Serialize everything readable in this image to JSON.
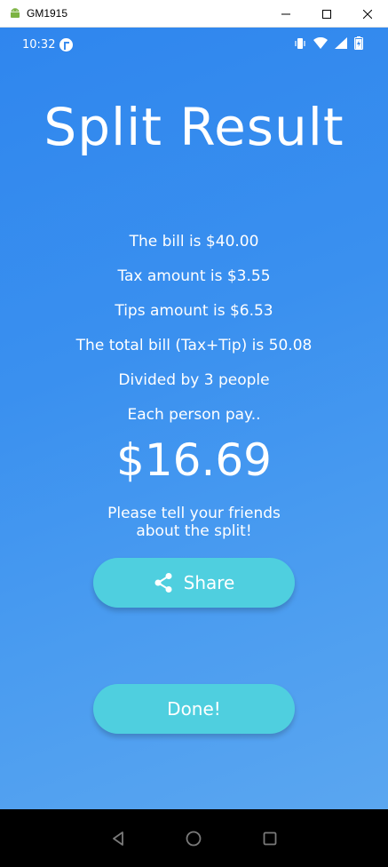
{
  "window": {
    "title": "GM1915"
  },
  "statusbar": {
    "time": "10:32"
  },
  "page": {
    "title": "Split Result",
    "lines": [
      "The bill is $40.00",
      "Tax amount is $3.55",
      "Tips amount is $6.53",
      "The total bill (Tax+Tip) is 50.08",
      "Divided by 3 people",
      "Each person pay.."
    ],
    "amount": "$16.69",
    "tell_line1": "Please tell your friends",
    "tell_line2": "about the split!",
    "share_label": "Share",
    "done_label": "Done!"
  },
  "colors": {
    "background_top": "#2f86ee",
    "background_bottom": "#5aa6f0",
    "button": "#4fcfdf"
  }
}
